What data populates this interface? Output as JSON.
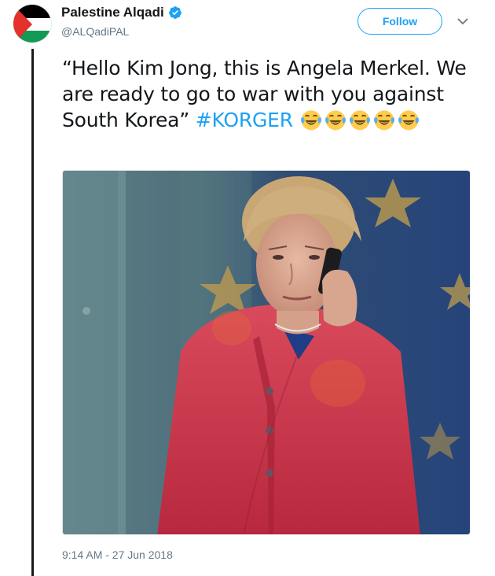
{
  "tweet": {
    "author": {
      "display_name": "Palestine Alqadi",
      "handle": "@ALQadiPAL",
      "verified": true,
      "avatar_icon": "palestine-flag-icon"
    },
    "follow_label": "Follow",
    "menu_icon": "chevron-down-icon",
    "text_main": "“Hello Kim Jong, this is Angela Merkel. We are ready to go to war with you against South Korea” ",
    "hashtag": "#KORGER",
    "emoji_name": "face-with-tears-of-joy-icon",
    "emoji_count": 5,
    "timestamp": "9:14 AM - 27 Jun 2018"
  },
  "colors": {
    "accent": "#1da1f2",
    "text": "#14171a",
    "muted": "#657786",
    "thread_line": "#1a1a1a"
  }
}
